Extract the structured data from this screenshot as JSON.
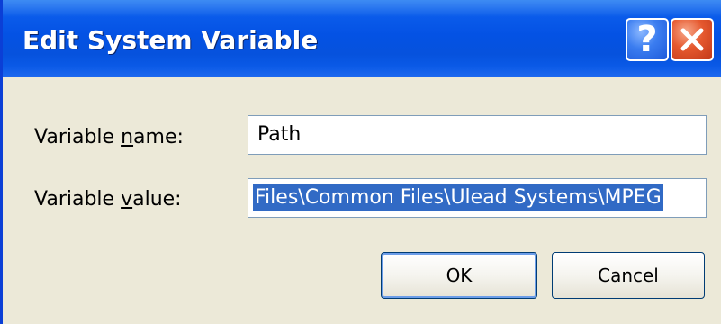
{
  "window": {
    "title": "Edit System Variable",
    "help_label": "?"
  },
  "form": {
    "name_label_pre": "Variable ",
    "name_label_accel": "n",
    "name_label_post": "ame:",
    "name_value": "Path",
    "value_label_pre": "Variable ",
    "value_label_accel": "v",
    "value_label_post": "alue:",
    "value_value": "Files\\Common Files\\Ulead Systems\\MPEG"
  },
  "buttons": {
    "ok": "OK",
    "cancel": "Cancel"
  },
  "colors": {
    "titlebar": "#0452E4",
    "selection": "#316AC5",
    "close": "#E5582E"
  }
}
